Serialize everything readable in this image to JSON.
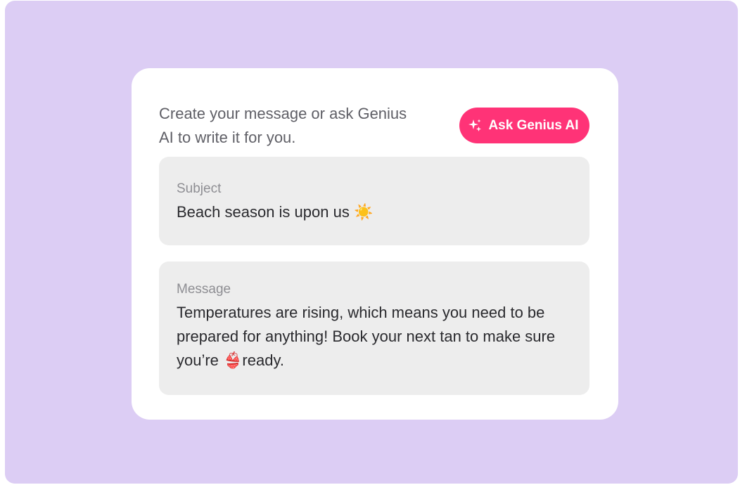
{
  "composer": {
    "intro_text": "Create your message or ask Genius AI to write it for you.",
    "ask_button": {
      "label": "Ask Genius AI",
      "icon": "sparkle-icon"
    },
    "subject": {
      "label": "Subject",
      "value": "Beach season is upon us ☀️"
    },
    "message": {
      "label": "Message",
      "value": "Temperatures are rising, which means you need to be prepared for anything! Book your next tan to make sure you’re 👙ready."
    }
  },
  "colors": {
    "background": "#dccdf4",
    "card": "#ffffff",
    "accent": "#ff3377",
    "field": "#ededed"
  }
}
